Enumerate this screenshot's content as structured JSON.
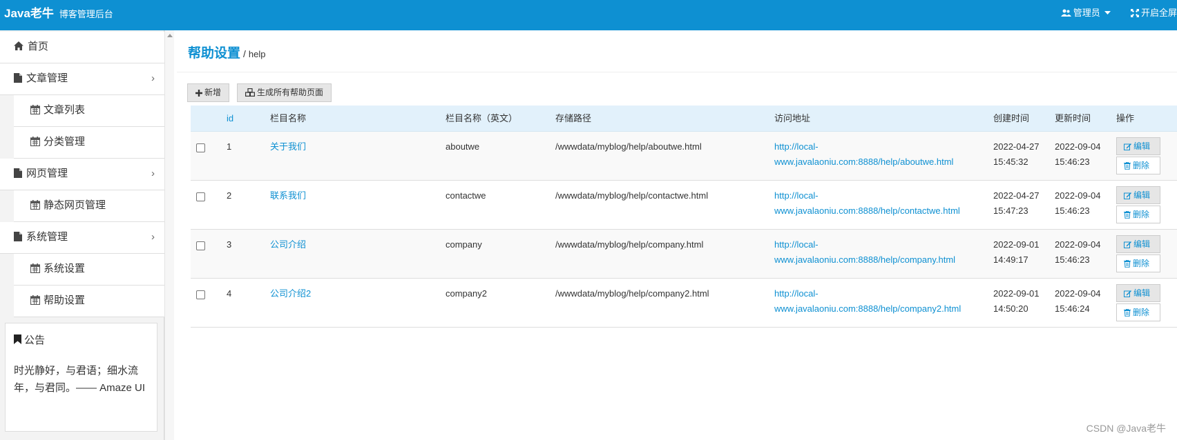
{
  "topbar": {
    "brand": "Java老牛",
    "subtitle": "博客管理后台",
    "admin_label": "管理员",
    "fullscreen_label": "开启全屏"
  },
  "sidebar": {
    "items": [
      {
        "label": "首页",
        "icon": "home-icon"
      },
      {
        "label": "文章管理",
        "icon": "file-icon",
        "expandable": true
      },
      {
        "label": "文章列表",
        "icon": "calendar-icon"
      },
      {
        "label": "分类管理",
        "icon": "calendar-icon"
      },
      {
        "label": "网页管理",
        "icon": "file-icon",
        "expandable": true
      },
      {
        "label": "静态网页管理",
        "icon": "calendar-icon"
      },
      {
        "label": "系统管理",
        "icon": "file-icon",
        "expandable": true
      },
      {
        "label": "系统设置",
        "icon": "calendar-icon"
      },
      {
        "label": "帮助设置",
        "icon": "calendar-icon"
      }
    ],
    "notice": {
      "title": "公告",
      "body": "时光静好，与君语；细水流年，与君同。—— Amaze UI"
    }
  },
  "breadcrumb": {
    "title": "帮助设置",
    "separator": "/",
    "sub": "help"
  },
  "toolbar": {
    "add_label": "新增",
    "generate_label": "生成所有帮助页面"
  },
  "table": {
    "headers": {
      "id": "id",
      "name": "栏目名称",
      "name_en": "栏目名称（英文）",
      "path": "存储路径",
      "url": "访问地址",
      "created": "创建时间",
      "updated": "更新时间",
      "ops": "操作"
    },
    "rows": [
      {
        "id": "1",
        "name": "关于我们",
        "name_en": "aboutwe",
        "path": "/wwwdata/myblog/help/aboutwe.html",
        "url_line1": "http://local-",
        "url_line2": "www.javalaoniu.com:8888/help/aboutwe.html",
        "created_date": "2022-04-27",
        "created_time": "15:45:32",
        "updated_date": "2022-09-04",
        "updated_time": "15:46:23"
      },
      {
        "id": "2",
        "name": "联系我们",
        "name_en": "contactwe",
        "path": "/wwwdata/myblog/help/contactwe.html",
        "url_line1": "http://local-",
        "url_line2": "www.javalaoniu.com:8888/help/contactwe.html",
        "created_date": "2022-04-27",
        "created_time": "15:47:23",
        "updated_date": "2022-09-04",
        "updated_time": "15:46:23"
      },
      {
        "id": "3",
        "name": "公司介绍",
        "name_en": "company",
        "path": "/wwwdata/myblog/help/company.html",
        "url_line1": "http://local-",
        "url_line2": "www.javalaoniu.com:8888/help/company.html",
        "created_date": "2022-09-01",
        "created_time": "14:49:17",
        "updated_date": "2022-09-04",
        "updated_time": "15:46:23"
      },
      {
        "id": "4",
        "name": "公司介绍2",
        "name_en": "company2",
        "path": "/wwwdata/myblog/help/company2.html",
        "url_line1": "http://local-",
        "url_line2": "www.javalaoniu.com:8888/help/company2.html",
        "created_date": "2022-09-01",
        "created_time": "14:50:20",
        "updated_date": "2022-09-04",
        "updated_time": "15:46:24"
      }
    ],
    "edit_label": "编辑",
    "delete_label": "删除"
  },
  "watermark": "CSDN @Java老牛",
  "colors": {
    "primary": "#0e90d2",
    "header_row": "#e2f1fb",
    "sidebar_bg": "#f3f3f3"
  }
}
